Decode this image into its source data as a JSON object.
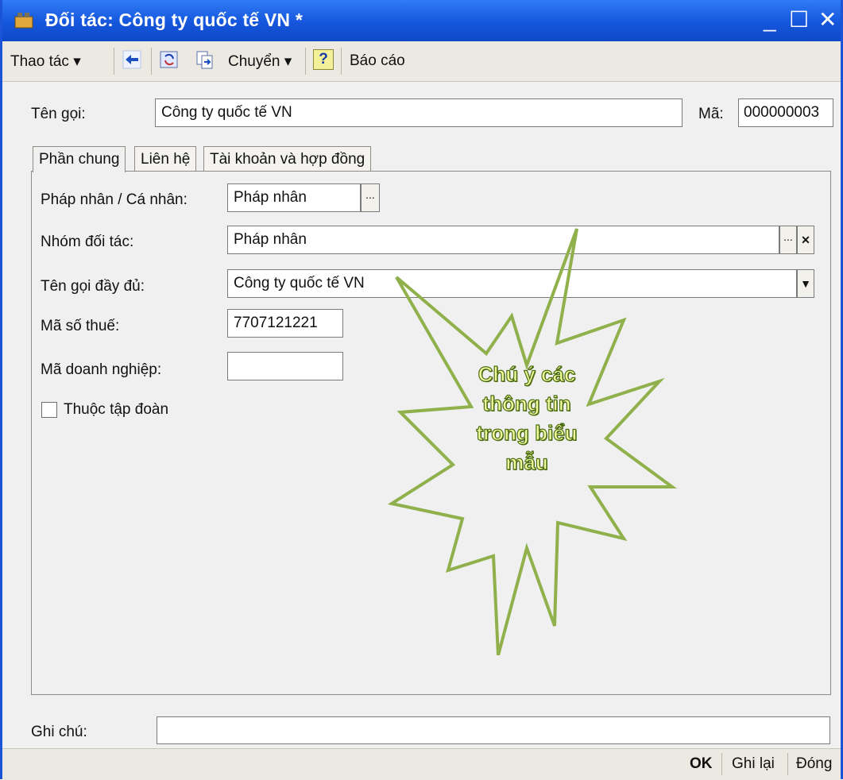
{
  "window": {
    "title": "Đối tác: Công ty quốc tế VN *",
    "minimize_glyph": "_",
    "maximize_glyph": "☐",
    "close_glyph": "✕"
  },
  "toolbar": {
    "actions_label": "Thao tác ▾",
    "move_label": "Chuyển ▾",
    "help_glyph": "?",
    "report_label": "Báo cáo"
  },
  "header": {
    "name_label": "Tên gọi:",
    "name_value": "Công ty quốc tế VN",
    "code_label": "Mã:",
    "code_value": "000000003"
  },
  "tabs": [
    {
      "label": "Phần chung"
    },
    {
      "label": "Liên hệ"
    },
    {
      "label": "Tài khoản và hợp đồng"
    }
  ],
  "form": {
    "entity_type_label": "Pháp nhân / Cá nhân:",
    "entity_type_value": "Pháp nhân",
    "partner_group_label": "Nhóm đối tác:",
    "partner_group_value": "Pháp nhân",
    "full_name_label": "Tên gọi đầy đủ:",
    "full_name_value": "Công ty quốc tế VN",
    "tax_code_label": "Mã số thuế:",
    "tax_code_value": "7707121221",
    "business_code_label": "Mã doanh nghiệp:",
    "business_code_value": "",
    "group_member_label": "Thuộc tập đoàn",
    "ellipsis_glyph": "...",
    "clear_glyph": "✕",
    "dropdown_glyph": "▼"
  },
  "notes": {
    "label": "Ghi chú:",
    "value": ""
  },
  "footer": {
    "ok_label": "OK",
    "save_label": "Ghi lại",
    "close_label": "Đóng"
  },
  "callout": {
    "lines": [
      "Chú ý các",
      "thông tin",
      "trong biểu",
      "mẫu"
    ]
  },
  "colors": {
    "titlebar": "#1556dc",
    "callout_outline": "#8fb04a",
    "callout_text": "#f3ff9c"
  }
}
